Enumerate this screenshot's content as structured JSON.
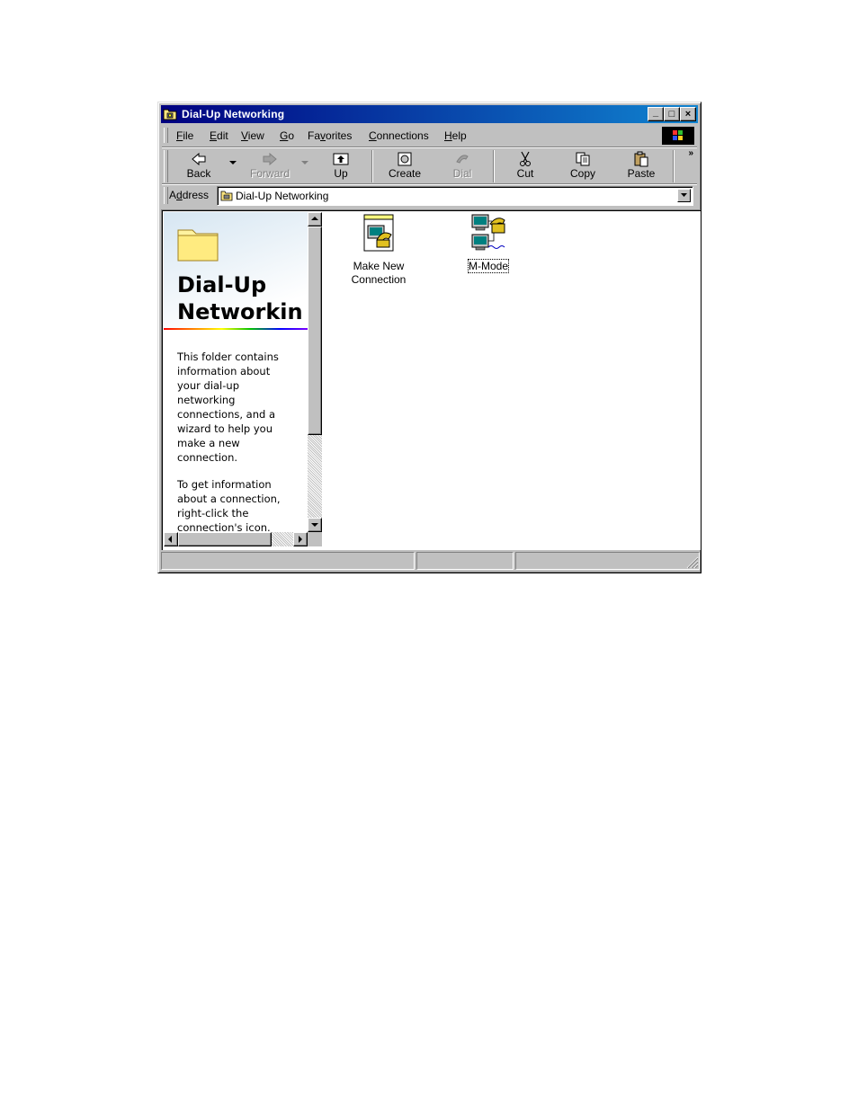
{
  "window": {
    "title": "Dial-Up Networking",
    "controls": {
      "minimize": "_",
      "maximize": "□",
      "close": "×"
    }
  },
  "menu": {
    "items": [
      {
        "label": "File",
        "key": "F",
        "rest": "ile"
      },
      {
        "label": "Edit",
        "key": "E",
        "rest": "dit"
      },
      {
        "label": "View",
        "key": "V",
        "rest": "iew"
      },
      {
        "label": "Go",
        "key": "G",
        "rest": "o"
      },
      {
        "label": "Favorites",
        "pre": "Fa",
        "key": "v",
        "rest": "orites"
      },
      {
        "label": "Connections",
        "key": "C",
        "rest": "onnections"
      },
      {
        "label": "Help",
        "key": "H",
        "rest": "elp"
      }
    ]
  },
  "toolbar": {
    "back": "Back",
    "forward": "Forward",
    "up": "Up",
    "create": "Create",
    "dial": "Dial",
    "cut": "Cut",
    "copy": "Copy",
    "paste": "Paste",
    "more": "»"
  },
  "address": {
    "label_pre": "A",
    "label_key": "d",
    "label_rest": "dress",
    "value": "Dial-Up Networking"
  },
  "left_pane": {
    "title_line1": "Dial-Up",
    "title_line2": "Networkin",
    "description": [
      "This folder contains",
      "information about",
      "your dial-up",
      "networking",
      "connections, and a",
      "wizard to help you",
      "make a new",
      "connection."
    ],
    "hint": [
      "To get information",
      "about a connection,",
      "right-click the",
      "connection's icon."
    ]
  },
  "icons": [
    {
      "line1": "Make New",
      "line2": "Connection",
      "selected": false
    },
    {
      "line1": "M-Mode",
      "line2": "",
      "selected": true
    }
  ],
  "colors": {
    "titlebar_start": "#000080",
    "titlebar_end": "#1084d0",
    "face": "#c0c0c0"
  }
}
